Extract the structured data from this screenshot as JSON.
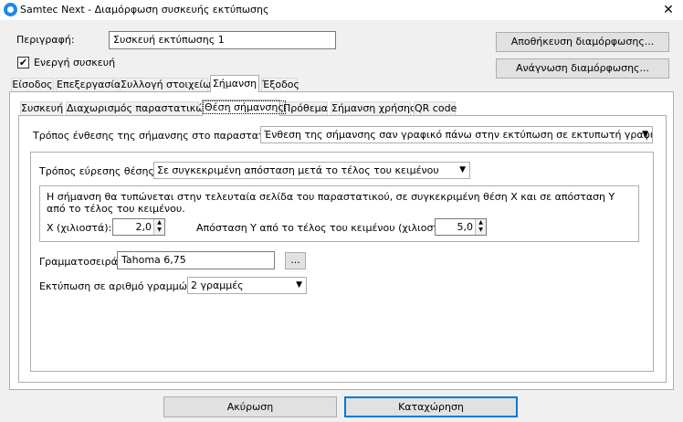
{
  "window": {
    "title": "Samtec Next - Διαμόρφωση συσκευής εκτύπωσης",
    "close": "✕"
  },
  "header": {
    "description_label": "Περιγραφή:",
    "description_value": "Συσκευή εκτύπωσης 1",
    "active_label": "Ενεργή συσκευή",
    "save_button": "Αποθήκευση διαμόρφωσης...",
    "read_button": "Ανάγνωση διαμόρφωσης..."
  },
  "main_tabs": [
    "Είσοδος",
    "Επεξεργασία",
    "Συλλογή στοιχείων",
    "Σήμανση",
    "Έξοδος"
  ],
  "sub_tabs": [
    "Συσκευή",
    "Διαχωρισμός παραστατικών",
    "Θέση σήμανσης",
    "Πρόθεμα",
    "Σήμανση χρήσης",
    "QR code"
  ],
  "placement": {
    "mode_label": "Τρόπος ένθεσης της σήμανσης στο παραστατικό:",
    "mode_value": "Ένθεση της σήμανσης σαν γραφικό πάνω στην εκτύπωση σε εκτυπωτή γραφικών",
    "position_label": "Τρόπος εύρεσης θέσης:",
    "position_value": "Σε συγκεκριμένη απόσταση μετά το τέλος του κειμένου",
    "info_line1": "Η σήμανση θα τυπώνεται στην τελευταία σελίδα του παραστατικού, σε συγκεκριμένη θέση X και σε απόσταση Y",
    "info_line2": "από το τέλος του κειμένου.",
    "x_label": "X (χιλιοστά):",
    "x_value": "2,0",
    "y_label": "Απόσταση Y από το τέλος του κειμένου (χιλιοστά):",
    "y_value": "5,0",
    "font_label": "Γραμματοσειρά:",
    "font_value": "Tahoma 6,75",
    "font_button": "...",
    "lines_label": "Εκτύπωση σε αριθμό γραμμών:",
    "lines_value": "2 γραμμές"
  },
  "footer": {
    "cancel": "Ακύρωση",
    "ok": "Καταχώρηση"
  },
  "icons": {
    "dropdown": "▼",
    "spin_up": "▲",
    "spin_down": "▼",
    "check": "✔"
  }
}
